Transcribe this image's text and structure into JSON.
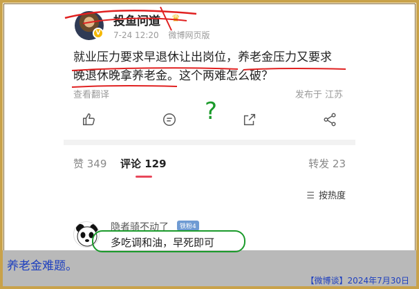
{
  "post": {
    "username": "投鱼问道",
    "time": "7-24 12:20",
    "client": "微博网页版",
    "text_line1": "就业压力要求早退休让出岗位，养老金压力又要求",
    "text_line2": "晚退休晚拿养老金。这个两难怎么破？",
    "translate_label": "查看翻译",
    "location": "发布于 江苏"
  },
  "tabs": {
    "likes": "赞 349",
    "comments": "评论 129",
    "reposts": "转发 23"
  },
  "sort_label": "按热度",
  "comment": {
    "name": "隐者骑不动了",
    "badge": "铁粉4",
    "text": "多吃调和油，早死即可"
  },
  "caption": "养老金难题。",
  "source": "【微博谈】2024年7月30日",
  "annotations": {
    "question_mark": "?"
  },
  "colors": {
    "accent_tab": "#e8475a",
    "annotation_red": "#e02020",
    "annotation_green": "#1a9a2a",
    "caption_text": "#1d3fbf"
  }
}
